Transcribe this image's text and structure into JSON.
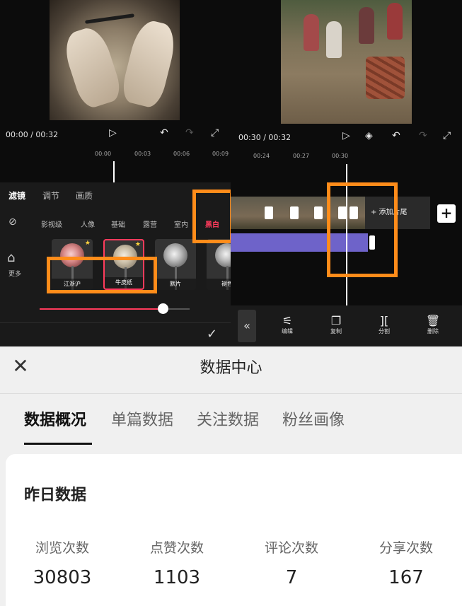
{
  "left_editor": {
    "time_current": "00:00",
    "time_total": "00:32",
    "ruler_ticks": [
      "00:00",
      "00:03",
      "00:06",
      "00:09"
    ],
    "tabs": [
      "滤镜",
      "调节",
      "画质"
    ],
    "active_tab": "滤镜",
    "categories": [
      "影视级",
      "人像",
      "基础",
      "露营",
      "室内",
      "黑白"
    ],
    "highlight_category": "黑白",
    "more_label": "更多",
    "filters": [
      {
        "name": "江浙沪",
        "star": true
      },
      {
        "name": "牛皮纸",
        "star": true
      },
      {
        "name": "默片",
        "star": false
      },
      {
        "name": "褪色",
        "star": false
      }
    ],
    "intensity": 0.82
  },
  "right_editor": {
    "time_current": "00:30",
    "time_total": "00:32",
    "ruler_ticks": [
      "00:24",
      "00:27",
      "00:30"
    ],
    "add_end_label": "+ 添加片尾",
    "plus_label": "+",
    "tools": [
      {
        "icon": "adjust-icon",
        "label": "编辑"
      },
      {
        "icon": "copy-icon",
        "label": "复制"
      },
      {
        "icon": "split-icon",
        "label": "分割"
      },
      {
        "icon": "trash-icon",
        "label": "删除"
      }
    ],
    "collapse_label": "«"
  },
  "data_center": {
    "title": "数据中心",
    "tabs": [
      "数据概况",
      "单篇数据",
      "关注数据",
      "粉丝画像"
    ],
    "active_tab": "数据概况",
    "section_title": "昨日数据",
    "stats": [
      {
        "label": "浏览次数",
        "value": "30803"
      },
      {
        "label": "点赞次数",
        "value": "1103"
      },
      {
        "label": "评论次数",
        "value": "7"
      },
      {
        "label": "分享次数",
        "value": "167"
      }
    ]
  },
  "colors": {
    "highlight_orange": "#ff8c1a",
    "accent_red": "#ff3b5c",
    "track_purple": "#6e63c9"
  }
}
